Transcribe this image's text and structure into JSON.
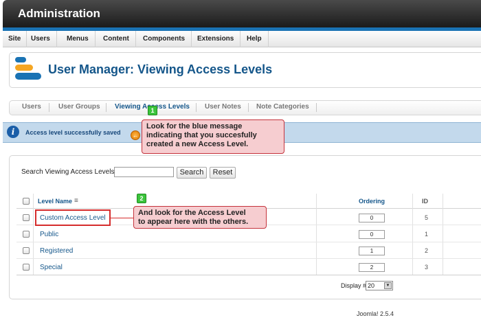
{
  "header": {
    "title": "Administration"
  },
  "menu": {
    "items": [
      "Site",
      "Users",
      "Menus",
      "Content",
      "Components",
      "Extensions",
      "Help"
    ]
  },
  "page": {
    "title": "User Manager: Viewing Access Levels",
    "icon": "users-icon"
  },
  "tabs": [
    "Users",
    "User Groups",
    "Viewing Access Levels",
    "User Notes",
    "Note Categories"
  ],
  "message": {
    "text": "Access level successfully saved",
    "icon": "info-icon"
  },
  "callouts": {
    "one": {
      "badge": "1",
      "lines": [
        "Look for the blue message",
        "indicating that you succesfully",
        "created a new Access Level."
      ]
    },
    "two": {
      "badge": "2",
      "lines": [
        "And look for the Access Level",
        "to appear here with the others."
      ]
    }
  },
  "search": {
    "label": "Search Viewing Access Levels",
    "value": "",
    "search_button": "Search",
    "reset_button": "Reset"
  },
  "table": {
    "headers": {
      "level_name": "Level Name",
      "ordering": "Ordering",
      "id": "ID"
    },
    "rows": [
      {
        "name": "Custom Access Level",
        "ordering": "0",
        "id": "5"
      },
      {
        "name": "Public",
        "ordering": "0",
        "id": "1"
      },
      {
        "name": "Registered",
        "ordering": "1",
        "id": "2"
      },
      {
        "name": "Special",
        "ordering": "2",
        "id": "3"
      }
    ]
  },
  "pagination": {
    "display_label": "Display #",
    "display_value": "20"
  },
  "footer": {
    "version": "Joomla! 2.5.4"
  },
  "colors": {
    "accent": "#14568a",
    "header_bar": "#1a73b4",
    "message_bg": "#c3d9ec",
    "callout_bg": "#f6cdd0",
    "callout_border": "#c4323b",
    "badge": "#3cc43c"
  }
}
